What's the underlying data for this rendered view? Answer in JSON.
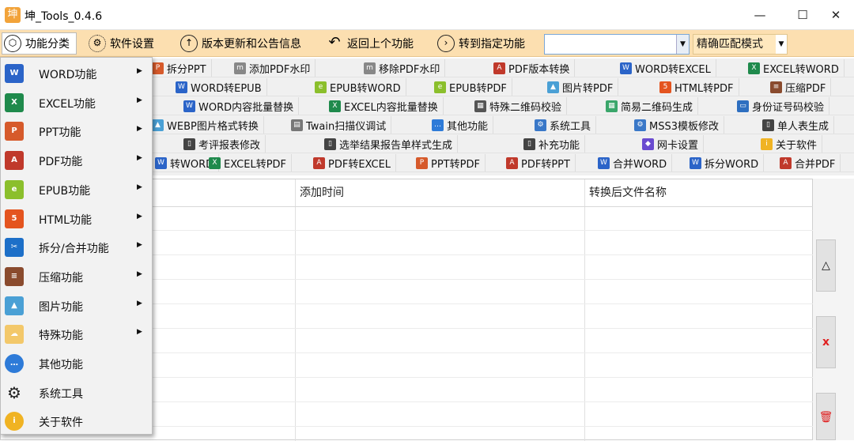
{
  "window": {
    "title": "坤_Tools_0.4.6",
    "minimize": "—",
    "maximize": "☐",
    "close": "✕"
  },
  "toolbar": {
    "categories": "功能分类",
    "settings": "软件设置",
    "updates": "版本更新和公告信息",
    "back": "返回上个功能",
    "goto": "转到指定功能",
    "search_value": "",
    "mode": "精确匹配模式"
  },
  "grid_rows": [
    [
      {
        "label": "拆分PPT",
        "icon": "ppt"
      },
      {
        "label": "添加PDF水印",
        "icon": "wm"
      },
      {
        "label": "移除PDF水印",
        "icon": "wm"
      },
      {
        "label": "PDF版本转换",
        "icon": "pdf"
      },
      {
        "label": "WORD转EXCEL",
        "icon": "word"
      },
      {
        "label": "EXCEL转WORD",
        "icon": "excel"
      }
    ],
    [
      {
        "label": "WORD转EPUB",
        "icon": "word"
      },
      {
        "label": "EPUB转WORD",
        "icon": "epub"
      },
      {
        "label": "EPUB转PDF",
        "icon": "epub"
      },
      {
        "label": "图片转PDF",
        "icon": "img"
      },
      {
        "label": "HTML转PDF",
        "icon": "html"
      },
      {
        "label": "压缩PDF",
        "icon": "zip"
      }
    ],
    [
      {
        "label": "WORD内容批量替换",
        "icon": "word"
      },
      {
        "label": "EXCEL内容批量替换",
        "icon": "excel"
      },
      {
        "label": "特殊二维码校验",
        "icon": "qr"
      },
      {
        "label": "简易二维码生成",
        "icon": "qr2"
      },
      {
        "label": "身份证号码校验",
        "icon": "id"
      }
    ],
    [
      {
        "label": "WEBP图片格式转换",
        "icon": "img"
      },
      {
        "label": "Twain扫描仪调试",
        "icon": "scan"
      },
      {
        "label": "其他功能",
        "icon": "other"
      },
      {
        "label": "系统工具",
        "icon": "gear"
      },
      {
        "label": "MSS3模板修改",
        "icon": "gear"
      },
      {
        "label": "单人表生成",
        "icon": "doc"
      }
    ],
    [
      {
        "label": "考评报表修改",
        "icon": "doc"
      },
      {
        "label": "选举结果报告单样式生成",
        "icon": "doc"
      },
      {
        "label": "补充功能",
        "icon": "doc"
      },
      {
        "label": "网卡设置",
        "icon": "net"
      },
      {
        "label": "关于软件",
        "icon": "info"
      }
    ],
    [
      {
        "label": "转WORD",
        "icon": "word"
      },
      {
        "label": "EXCEL转PDF",
        "icon": "excel"
      },
      {
        "label": "PDF转EXCEL",
        "icon": "pdf"
      },
      {
        "label": "PPT转PDF",
        "icon": "ppt"
      },
      {
        "label": "PDF转PPT",
        "icon": "pdf"
      },
      {
        "label": "合并WORD",
        "icon": "word"
      },
      {
        "label": "拆分WORD",
        "icon": "word"
      },
      {
        "label": "合并PDF",
        "icon": "pdf"
      }
    ]
  ],
  "table": {
    "columns": [
      "",
      "添加时间",
      "转换后文件名称"
    ]
  },
  "side_buttons": {
    "up": "△",
    "delete": "x",
    "clear": "🗑"
  },
  "menu": [
    {
      "label": "WORD功能",
      "icon": "word",
      "arrow": "▶"
    },
    {
      "label": "EXCEL功能",
      "icon": "excel",
      "arrow": "▶"
    },
    {
      "label": "PPT功能",
      "icon": "ppt",
      "arrow": "▶"
    },
    {
      "label": "PDF功能",
      "icon": "pdf",
      "arrow": "▶"
    },
    {
      "label": "EPUB功能",
      "icon": "epub",
      "arrow": "▶"
    },
    {
      "label": "HTML功能",
      "icon": "html",
      "arrow": "▶"
    },
    {
      "label": "拆分/合并功能",
      "icon": "scissors",
      "arrow": "▶"
    },
    {
      "label": "压缩功能",
      "icon": "zip",
      "arrow": "▶"
    },
    {
      "label": "图片功能",
      "icon": "img",
      "arrow": "▶"
    },
    {
      "label": "特殊功能",
      "icon": "cloud",
      "arrow": "▶"
    },
    {
      "label": "其他功能",
      "icon": "other",
      "arrow": ""
    },
    {
      "label": "系统工具",
      "icon": "gear",
      "arrow": ""
    },
    {
      "label": "关于软件",
      "icon": "info",
      "arrow": ""
    }
  ],
  "colors": {
    "toolbar_bg": "#fcdfb0",
    "word": "#2b64c8",
    "excel": "#1f8a4c",
    "ppt": "#d65a2b",
    "pdf": "#d9534f",
    "epub": "#8bbf2c",
    "html": "#e4541f",
    "zip": "#8a4b2e",
    "img": "#4aa0d5",
    "info": "#f0b323",
    "other": "#2e7bd8"
  }
}
